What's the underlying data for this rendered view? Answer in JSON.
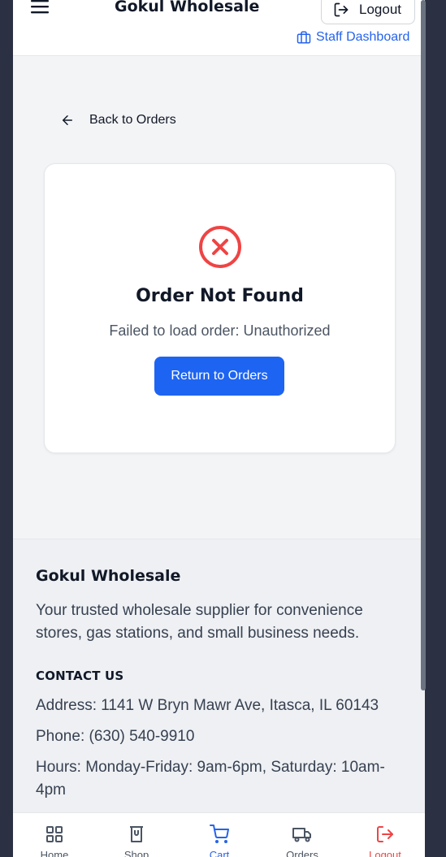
{
  "header": {
    "brand": "Gokul Wholesale",
    "logout_label": "Logout",
    "staff_label": "Staff Dashboard"
  },
  "back_label": "Back to Orders",
  "error_card": {
    "title": "Order Not Found",
    "message": "Failed to load order: Unauthorized",
    "button_label": "Return to Orders"
  },
  "footer": {
    "title": "Gokul Wholesale",
    "description": "Your trusted wholesale supplier for convenience stores, gas stations, and small business needs.",
    "contact_heading": "CONTACT US",
    "address": "Address: 1141 W Bryn Mawr Ave, Itasca, IL 60143",
    "phone": "Phone: (630) 540-9910",
    "hours": "Hours: Monday-Friday: 9am-6pm, Saturday: 10am-4pm"
  },
  "bottom_nav": {
    "items": [
      {
        "label": "Home",
        "icon": "grid-icon"
      },
      {
        "label": "Shop",
        "icon": "shop-icon"
      },
      {
        "label": "Cart",
        "icon": "cart-icon",
        "active": true
      },
      {
        "label": "Orders",
        "icon": "truck-icon"
      },
      {
        "label": "Logout",
        "icon": "logout-icon"
      }
    ]
  },
  "colors": {
    "accent": "#2563eb",
    "error": "#ef4444",
    "button": "#1d64f2"
  }
}
